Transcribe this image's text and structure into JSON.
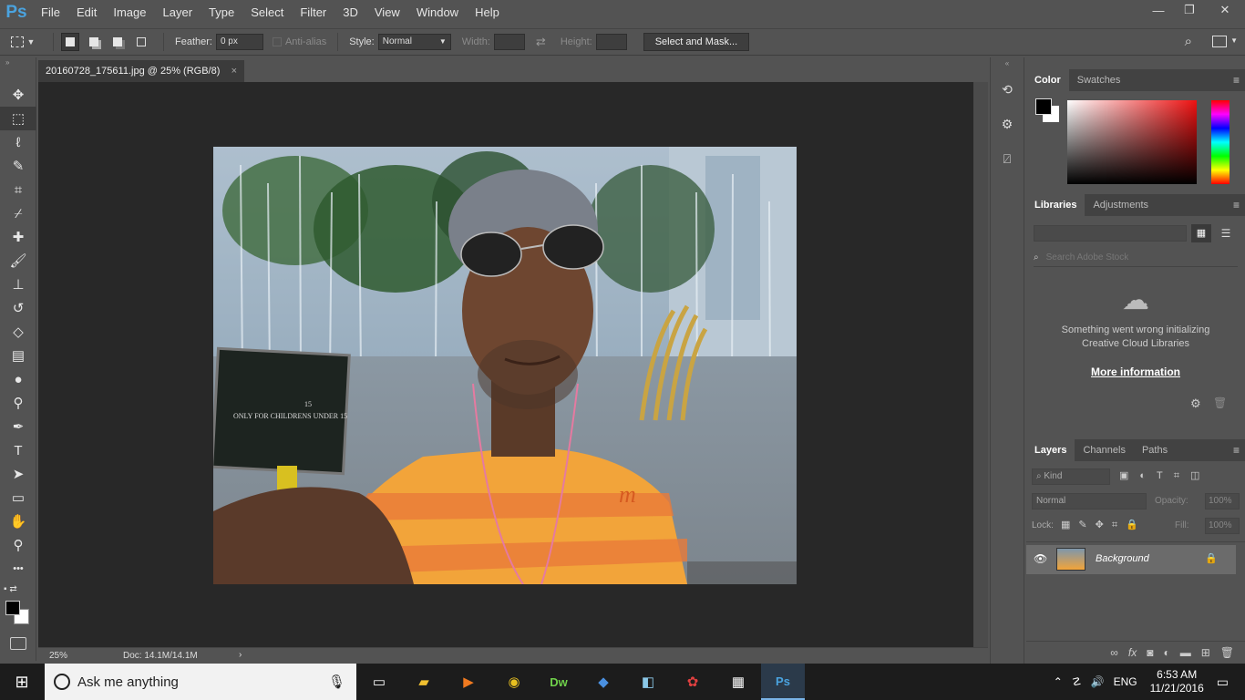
{
  "app": {
    "logo": "Ps"
  },
  "menu": [
    "File",
    "Edit",
    "Image",
    "Layer",
    "Type",
    "Select",
    "Filter",
    "3D",
    "View",
    "Window",
    "Help"
  ],
  "window_controls": {
    "minimize": "—",
    "restore": "❐",
    "close": "✕"
  },
  "options": {
    "feather_label": "Feather:",
    "feather_value": "0 px",
    "antialias_label": "Anti-alias",
    "style_label": "Style:",
    "style_value": "Normal",
    "width_label": "Width:",
    "height_label": "Height:",
    "select_mask_label": "Select and Mask..."
  },
  "tools": [
    {
      "name": "move-tool",
      "glyph": "✥"
    },
    {
      "name": "marquee-tool",
      "glyph": "⬚",
      "selected": true
    },
    {
      "name": "lasso-tool",
      "glyph": "ℓ"
    },
    {
      "name": "quick-selection-tool",
      "glyph": "✎"
    },
    {
      "name": "crop-tool",
      "glyph": "⌗"
    },
    {
      "name": "eyedropper-tool",
      "glyph": "⌿"
    },
    {
      "name": "healing-brush-tool",
      "glyph": "✚"
    },
    {
      "name": "brush-tool",
      "glyph": "🖌"
    },
    {
      "name": "clone-stamp-tool",
      "glyph": "⊥"
    },
    {
      "name": "history-brush-tool",
      "glyph": "↺"
    },
    {
      "name": "eraser-tool",
      "glyph": "◇"
    },
    {
      "name": "gradient-tool",
      "glyph": "▤"
    },
    {
      "name": "blur-tool",
      "glyph": "●"
    },
    {
      "name": "dodge-tool",
      "glyph": "⚲"
    },
    {
      "name": "pen-tool",
      "glyph": "✒"
    },
    {
      "name": "type-tool",
      "glyph": "T"
    },
    {
      "name": "path-selection-tool",
      "glyph": "➤"
    },
    {
      "name": "rectangle-tool",
      "glyph": "▭"
    },
    {
      "name": "hand-tool",
      "glyph": "✋"
    },
    {
      "name": "zoom-tool",
      "glyph": "⚲"
    },
    {
      "name": "more-tools",
      "glyph": "•••"
    }
  ],
  "document": {
    "tab_title": "20160728_175611.jpg @ 25% (RGB/8)",
    "close": "×"
  },
  "status": {
    "zoom": "25%",
    "doc": "Doc: 14.1M/14.1M",
    "arrow": "›"
  },
  "photo": {
    "sign_line1": "ONLY FOR CHILDRENS UNDER 15",
    "sign_line2": "15",
    "shirt_logo": "m"
  },
  "color_panel": {
    "tabs": [
      "Color",
      "Swatches"
    ],
    "fg": "#000000",
    "bg": "#ffffff"
  },
  "libraries_panel": {
    "tabs": [
      "Libraries",
      "Adjustments"
    ],
    "search_placeholder": "Search Adobe Stock",
    "error_line1": "Something went wrong initializing",
    "error_line2": "Creative Cloud Libraries",
    "more_info": "More information"
  },
  "layers_panel": {
    "tabs": [
      "Layers",
      "Channels",
      "Paths"
    ],
    "filter": "Kind",
    "blend": "Normal",
    "opacity_label": "Opacity:",
    "opacity_value": "100%",
    "lock_label": "Lock:",
    "fill_label": "Fill:",
    "fill_value": "100%",
    "layers": [
      {
        "name": "Background",
        "visible": true,
        "locked": true
      }
    ],
    "footer_icons": [
      "link-icon",
      "fx-icon",
      "mask-icon",
      "adjustment-icon",
      "folder-icon",
      "new-layer-icon",
      "trash-icon"
    ]
  },
  "taskbar": {
    "search_placeholder": "Ask me anything",
    "time": "6:53 AM",
    "date": "11/21/2016",
    "lang": "ENG"
  }
}
